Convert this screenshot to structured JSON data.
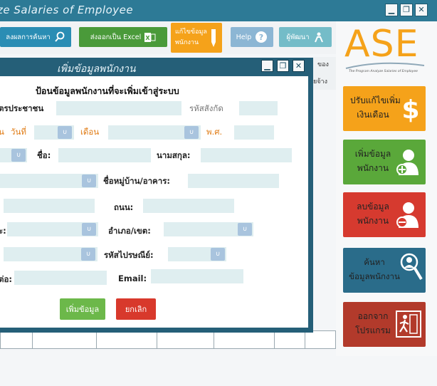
{
  "window": {
    "title": "ze Salaries of Employee",
    "minimize": "▁",
    "restore": "❐",
    "close": "✕"
  },
  "toolbar": {
    "search_label": "ลงผลการค้นหา",
    "export_excel_label": "ส่งออกเป็น Excel",
    "edit_employee_label_1": "แก้ไขข้อมูล",
    "edit_employee_label_2": "พนักงาน",
    "help_label": "Help",
    "developer_label": "ผู้พัฒนา"
  },
  "logo": {
    "text": "ASE",
    "tagline": "The Program Analyze Salaries of Employee"
  },
  "sidebar": {
    "items": [
      {
        "label_1": "ปรับแก้ไขเพิ่ม",
        "label_2": "เงินเดือน",
        "color": "#f5a21a"
      },
      {
        "label_1": "เพิ่มข้อมูล",
        "label_2": "พนักงาน",
        "color": "#5aa83a"
      },
      {
        "label_1": "ลบข้อมูล",
        "label_2": "พนักงาน",
        "color": "#d63a2f"
      },
      {
        "label_1": "ค้นหา",
        "label_2": "ข้อมูลพนักงาน",
        "color": "#2a6c8a"
      },
      {
        "label_1": "ออกจาก",
        "label_2": "โปรแกรม",
        "color": "#b23a2b"
      }
    ]
  },
  "background_table": {
    "header_partial_1": "ของ",
    "header_partial_2": "ยจ้าง"
  },
  "dialog": {
    "title": "เพิ่มข้อมูลพนักงาน",
    "subtitle": "ป้อนข้อมูลพนักงานที่จะเพิ่มเข้าสู่ระบบ",
    "labels": {
      "id_card": "ตรประชาชน",
      "dept_code": "รหัสสังกัด",
      "birth_partial": "น",
      "day": "วันที่",
      "month": "เดือน",
      "year": "พ.ศ.",
      "first_name": "ชื่อ:",
      "last_name": "นามสกุล:",
      "village": "ชื่อหมู่บ้าน/อาคาร:",
      "road": "ถนน:",
      "row5_partial": "ะ:",
      "district": "อำเภอ/เขต:",
      "postcode": "รหัสไปรษณีย์:",
      "contact_partial": "ต่อ:",
      "email": "Email:"
    },
    "dropdown_arrow": "∪",
    "add_button": "เพิ่มข้อมูล",
    "cancel_button": "ยกเลิก"
  },
  "colors": {
    "titlebar": "#2d7a96",
    "dialog_frame": "#255f78",
    "field_bg": "#dfeef0",
    "dropdown_btn": "#a9c4de",
    "accent_orange": "#f5a21a"
  }
}
